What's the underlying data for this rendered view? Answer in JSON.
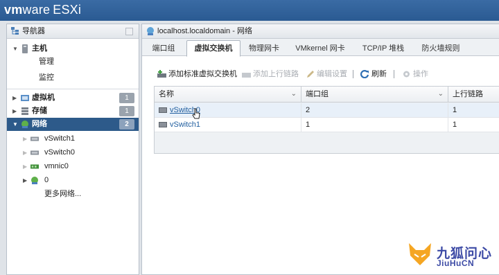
{
  "app": {
    "brand_vm": "vm",
    "brand_ware": "ware",
    "brand_esxi": "ESXi"
  },
  "navigator": {
    "title": "导航器",
    "host": {
      "label": "主机",
      "children": [
        "管理",
        "监控"
      ]
    },
    "vms": {
      "label": "虚拟机",
      "count": "1"
    },
    "storage": {
      "label": "存储",
      "count": "1"
    },
    "network": {
      "label": "网络",
      "count": "2",
      "children": [
        "vSwitch1",
        "vSwitch0",
        "vmnic0",
        "0"
      ],
      "more": "更多网络..."
    }
  },
  "main": {
    "title": "localhost.localdomain - 网络",
    "tabs": [
      "端口组",
      "虚拟交换机",
      "物理网卡",
      "VMkernel 网卡",
      "TCP/IP 堆栈",
      "防火墙规则"
    ],
    "active_tab": "虚拟交换机",
    "toolbar": {
      "add_switch": "添加标准虚拟交换机",
      "add_uplink": "添加上行链路",
      "edit": "编辑设置",
      "refresh": "刷新",
      "actions": "操作"
    },
    "table": {
      "columns": [
        "名称",
        "端口组",
        "上行链路"
      ],
      "rows": [
        {
          "name": "vSwitch0",
          "port_groups": "2",
          "uplinks": "1"
        },
        {
          "name": "vSwitch1",
          "port_groups": "1",
          "uplinks": "1"
        }
      ]
    }
  },
  "watermark": {
    "cn": "九狐问心",
    "en": "JiuHuCN"
  },
  "colors": {
    "topbar": "#2a5a92",
    "selected": "#2d5a8a",
    "link": "#1f5d9e"
  }
}
